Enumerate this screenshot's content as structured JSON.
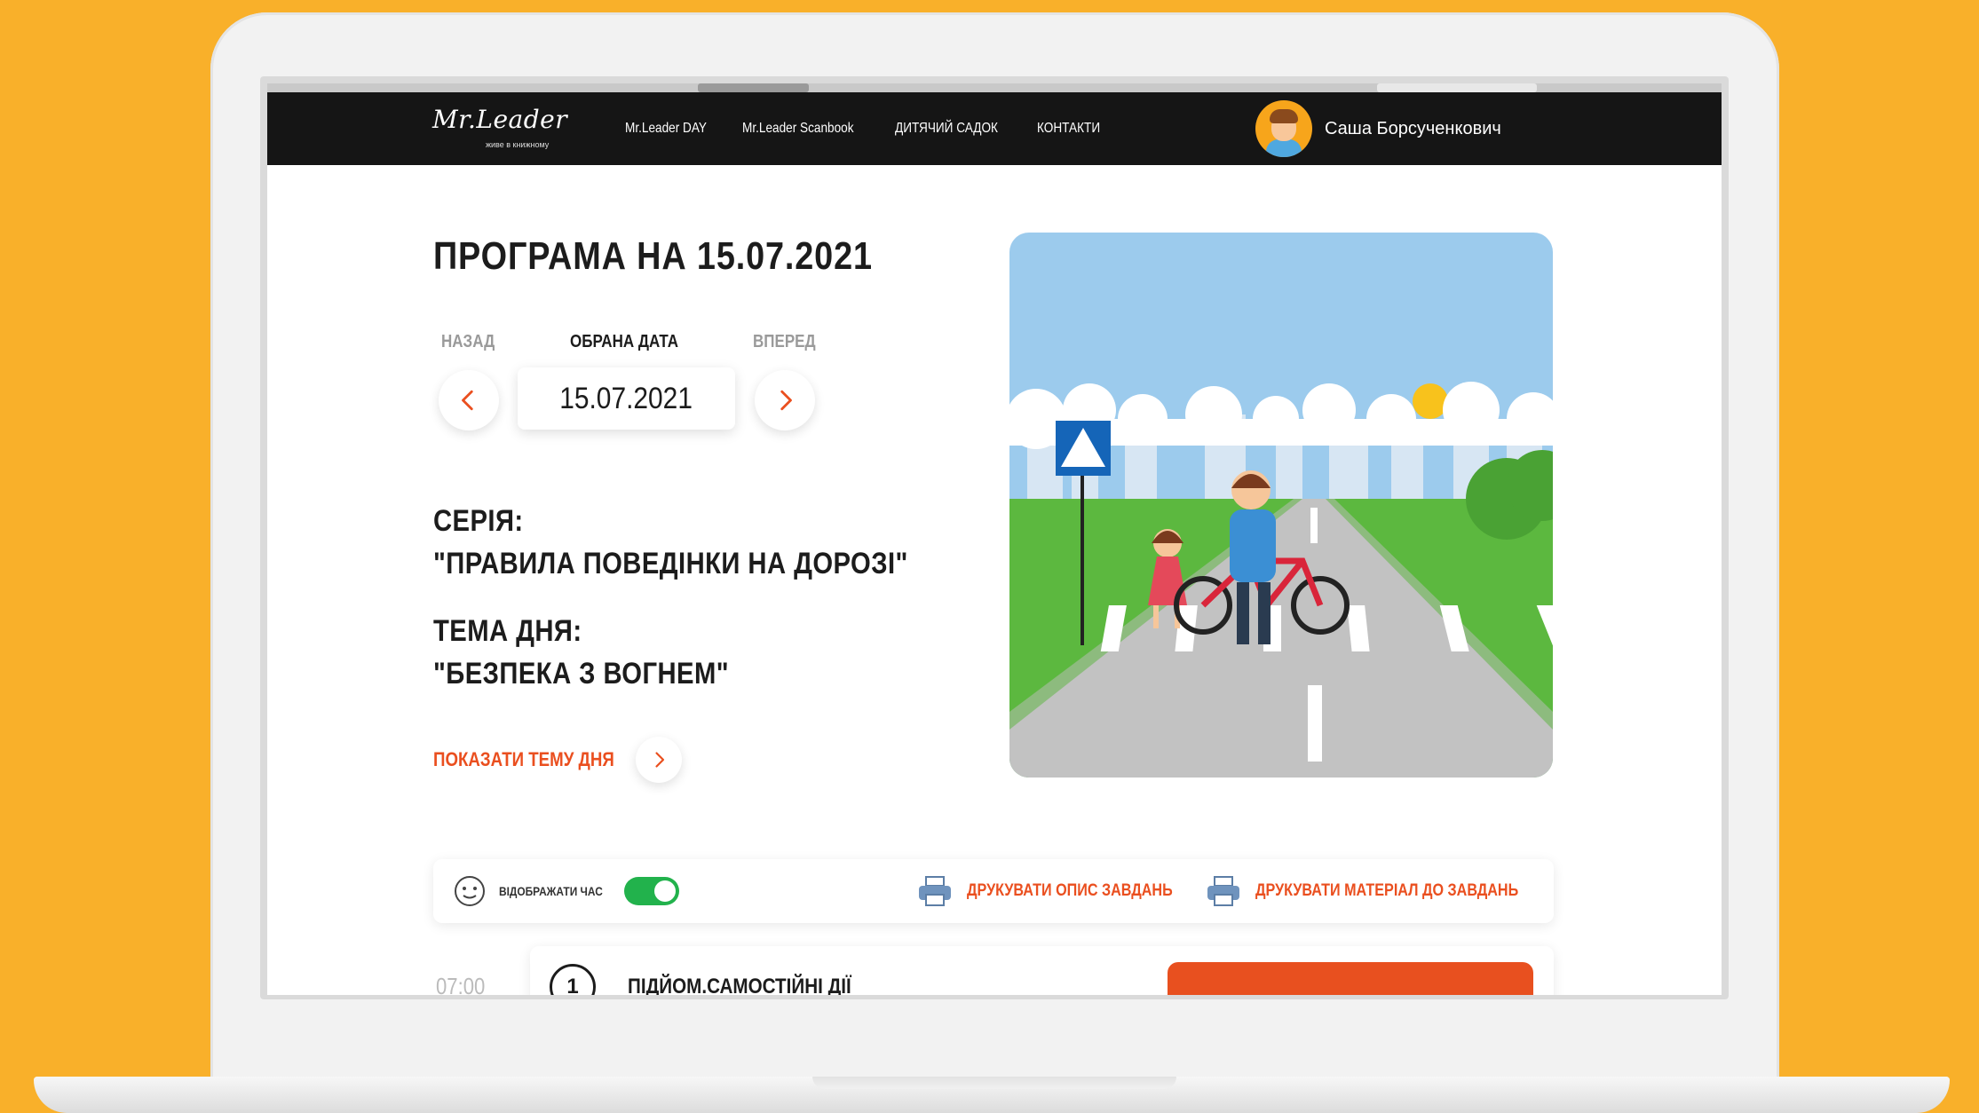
{
  "colors": {
    "background": "#f9b02a",
    "navbar": "#151515",
    "accent": "#ea4f1f",
    "toggle_on": "#22b24c"
  },
  "navbar": {
    "logo_text": "Mr.Leader",
    "logo_tagline": "живе в книжному",
    "links": [
      "Mr.Leader DAY",
      "Mr.Leader Scanbook",
      "ДИТЯЧИЙ САДОК",
      "КОНТАКТИ"
    ],
    "user_name": "Саша Борсученкович"
  },
  "program": {
    "title": "ПРОГРАМА НА 15.07.2021",
    "back_label": "НАЗАД",
    "selected_label": "ОБРАНА ДАТА",
    "forward_label": "ВПЕРЕД",
    "selected_date": "15.07.2021",
    "series_label": "СЕРІЯ:",
    "series_value": "\"ПРАВИЛА ПОВЕДІНКИ НА ДОРОЗІ\"",
    "topic_label": "ТЕМА ДНЯ:",
    "topic_value": "\"БЕЗПЕКА З ВОГНЕМ\"",
    "show_topic_label": "ПОКАЗАТИ ТЕМУ ДНЯ"
  },
  "toolbar": {
    "show_time_label": "ВІДОБРАЖАТИ ЧАС",
    "show_time_on": true,
    "print_description_label": "ДРУКУВАТИ ОПИС ЗАВДАНЬ",
    "print_material_label": "ДРУКУВАТИ МАТЕРІАЛ ДО ЗАВДАНЬ"
  },
  "tasks": [
    {
      "time": "07:00",
      "number": "1",
      "title": "ПІДЙОМ.САМОСТІЙНІ ДІЇ"
    }
  ],
  "icons": [
    "chevron-left-icon",
    "chevron-right-icon",
    "clock-face-icon",
    "printer-icon"
  ]
}
